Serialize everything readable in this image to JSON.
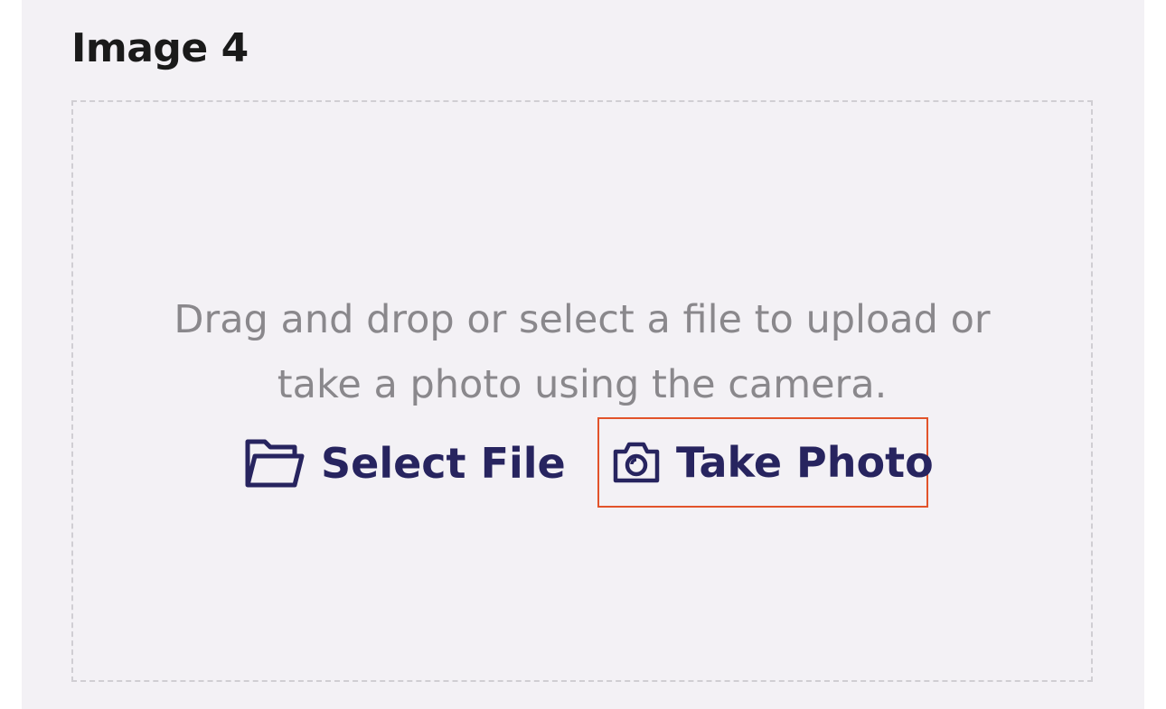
{
  "section": {
    "title": "Image 4"
  },
  "dropzone": {
    "instruction_line1": "Drag and drop or select a file to upload or",
    "instruction_line2": "take a photo using the camera.",
    "select_file_label": "Select File",
    "select_file_icon": "folder-icon",
    "take_photo_label": "Take Photo",
    "take_photo_icon": "camera-icon"
  },
  "colors": {
    "panel_background": "#f3f1f5",
    "action_text": "#27245f",
    "instruction_text": "#8a888c",
    "highlight_border": "#e2532a",
    "dropzone_border": "#d0ced3"
  }
}
